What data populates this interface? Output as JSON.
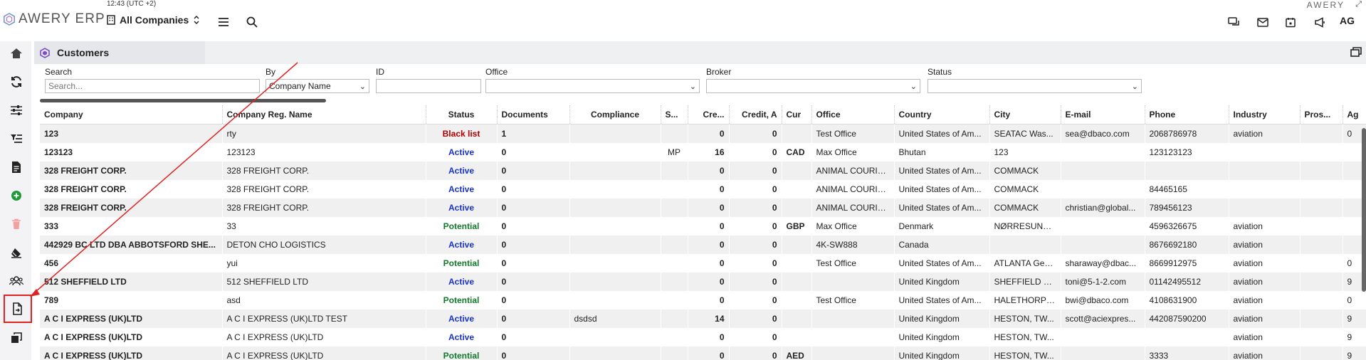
{
  "header": {
    "time": "12:43 (UTC +2)",
    "logo_text": "AWERY ERP",
    "company_selector": "All Companies",
    "brand_corner": "AWERY",
    "avatar": "AG"
  },
  "tab": {
    "label": "Customers"
  },
  "filters": {
    "search_label": "Search",
    "search_placeholder": "Search...",
    "by_label": "By",
    "by_value": "Company Name",
    "id_label": "ID",
    "office_label": "Office",
    "broker_label": "Broker",
    "status_label": "Status"
  },
  "columns": [
    "Company",
    "Company Reg. Name",
    "Status",
    "Documents",
    "Compliance",
    "S...",
    "Cre...",
    "Credit, A",
    "Cur",
    "Office",
    "Country",
    "City",
    "E-mail",
    "Phone",
    "Industry",
    "Pros...",
    "Ag"
  ],
  "rows": [
    {
      "company": "123",
      "reg": "rty",
      "status": "Black list",
      "status_type": "black",
      "docs": "1",
      "compliance": "",
      "s": "",
      "cre": "0",
      "credit": "0",
      "cur": "",
      "office": "Test Office",
      "country": "United States of Am...",
      "city": "SEATAC Was...",
      "email": "sea@dbaco.com",
      "phone": "2068786978",
      "industry": "aviation",
      "pros": "",
      "ag": "0"
    },
    {
      "company": "123123",
      "reg": "123123",
      "status": "Active",
      "status_type": "active",
      "docs": "0",
      "compliance": "",
      "s": "MP",
      "cre": "16",
      "credit": "0",
      "cur": "CAD",
      "office": "Max Office",
      "country": "Bhutan",
      "city": "123",
      "email": "",
      "phone": "123123123",
      "industry": "",
      "pros": "",
      "ag": ""
    },
    {
      "company": "328 FREIGHT CORP.",
      "reg": "328 FREIGHT CORP.",
      "status": "Active",
      "status_type": "active",
      "docs": "0",
      "compliance": "",
      "s": "",
      "cre": "0",
      "credit": "0",
      "cur": "",
      "office": "ANIMAL COURIE...",
      "country": "United States of Am...",
      "city": "COMMACK",
      "email": "",
      "phone": "",
      "industry": "",
      "pros": "",
      "ag": ""
    },
    {
      "company": "328 FREIGHT CORP.",
      "reg": "328 FREIGHT CORP.",
      "status": "Active",
      "status_type": "active",
      "docs": "0",
      "compliance": "",
      "s": "",
      "cre": "0",
      "credit": "0",
      "cur": "",
      "office": "ANIMAL COURIE...",
      "country": "United States of Am...",
      "city": "COMMACK",
      "email": "",
      "phone": "84465165",
      "industry": "",
      "pros": "",
      "ag": ""
    },
    {
      "company": "328 FREIGHT CORP.",
      "reg": "328 FREIGHT CORP.",
      "status": "Active",
      "status_type": "active",
      "docs": "0",
      "compliance": "",
      "s": "",
      "cre": "0",
      "credit": "0",
      "cur": "",
      "office": "ANIMAL COURIE...",
      "country": "United States of Am...",
      "city": "COMMACK",
      "email": "christian@global...",
      "phone": "789456123",
      "industry": "",
      "pros": "",
      "ag": ""
    },
    {
      "company": "333",
      "reg": "33",
      "status": "Potential",
      "status_type": "potential",
      "docs": "0",
      "compliance": "",
      "s": "",
      "cre": "0",
      "credit": "0",
      "cur": "GBP",
      "office": "Max Office",
      "country": "Denmark",
      "city": "NØRRESUND...",
      "email": "",
      "phone": "4596326675",
      "industry": "aviation",
      "pros": "",
      "ag": ""
    },
    {
      "company": "442929 BC LTD DBA ABBOTSFORD SHE...",
      "reg": "DETON CHO LOGISTICS",
      "status": "Active",
      "status_type": "active",
      "docs": "0",
      "compliance": "",
      "s": "",
      "cre": "0",
      "credit": "0",
      "cur": "",
      "office": "4K-SW888",
      "country": "Canada",
      "city": "",
      "email": "",
      "phone": "8676692180",
      "industry": "aviation",
      "pros": "",
      "ag": ""
    },
    {
      "company": "456",
      "reg": "yui",
      "status": "Potential",
      "status_type": "potential",
      "docs": "0",
      "compliance": "",
      "s": "",
      "cre": "0",
      "credit": "0",
      "cur": "",
      "office": "Test Office",
      "country": "United States of Am...",
      "city": "ATLANTA Geo...",
      "email": "sharaway@dbac...",
      "phone": "8669912975",
      "industry": "aviation",
      "pros": "",
      "ag": "0"
    },
    {
      "company": "512 SHEFFIELD LTD",
      "reg": "512 SHEFFIELD LTD",
      "status": "Active",
      "status_type": "active",
      "docs": "0",
      "compliance": "",
      "s": "",
      "cre": "0",
      "credit": "0",
      "cur": "",
      "office": "",
      "country": "United Kingdom",
      "city": "SHEFFIELD S...",
      "email": "toni@5-1-2.com",
      "phone": "01142495512",
      "industry": "aviation",
      "pros": "",
      "ag": "9"
    },
    {
      "company": "789",
      "reg": "asd",
      "status": "Potential",
      "status_type": "potential",
      "docs": "0",
      "compliance": "",
      "s": "",
      "cre": "0",
      "credit": "0",
      "cur": "",
      "office": "Test Office",
      "country": "United States of Am...",
      "city": "HALETHORPE...",
      "email": "bwi@dbaco.com",
      "phone": "4108631900",
      "industry": "aviation",
      "pros": "",
      "ag": "0"
    },
    {
      "company": "A C I EXPRESS (UK)LTD",
      "reg": "A C I EXPRESS (UK)LTD TEST",
      "status": "Active",
      "status_type": "active",
      "docs": "0",
      "compliance": "dsdsd",
      "s": "",
      "cre": "14",
      "credit": "0",
      "cur": "",
      "office": "",
      "country": "United Kingdom",
      "city": "HESTON, TW...",
      "email": "scott@aciexpres...",
      "phone": "442087590200",
      "industry": "aviation",
      "pros": "",
      "ag": "9"
    },
    {
      "company": "A C I EXPRESS (UK)LTD",
      "reg": "A C I EXPRESS (UK)LTD",
      "status": "Active",
      "status_type": "active",
      "docs": "0",
      "compliance": "",
      "s": "",
      "cre": "0",
      "credit": "0",
      "cur": "",
      "office": "",
      "country": "United Kingdom",
      "city": "HESTON, TW...",
      "email": "",
      "phone": "",
      "industry": "aviation",
      "pros": "",
      "ag": "9"
    },
    {
      "company": "A C I EXPRESS (UK)LTD",
      "reg": "A C I EXPRESS (UK)LTD",
      "status": "Potential",
      "status_type": "potential",
      "docs": "0",
      "compliance": "",
      "s": "",
      "cre": "0",
      "credit": "0",
      "cur": "AED",
      "office": "",
      "country": "United Kingdom",
      "city": "HESTON, TW...",
      "email": "",
      "phone": "3333",
      "industry": "aviation",
      "pros": "",
      "ag": "9"
    }
  ],
  "colors": {
    "accent": "#e02424",
    "active": "#1a33c8",
    "potential": "#117a2a",
    "blacklist": "#b00000"
  }
}
